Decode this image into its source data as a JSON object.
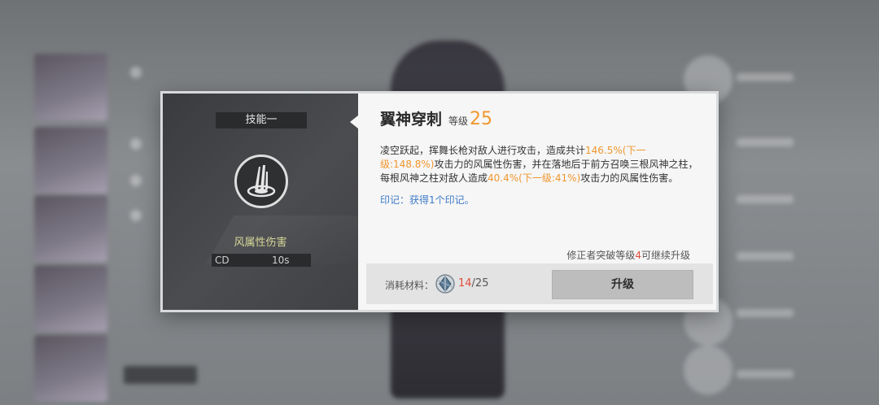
{
  "dialog": {
    "skill_slot": "技能一",
    "skill_icon": "wind-spear-skill-icon",
    "damage_type": "风属性伤害",
    "cd_label": "CD",
    "cd_value": "10s",
    "title": "翼神穿刺",
    "level_label": "等级",
    "level_value": "25",
    "description": {
      "p1": "凌空跃起，挥舞长枪对敌人进行攻击，造成共计",
      "v1": "146.5%(下一级:148.8%)",
      "p2": "攻击力的风属性伤害，并在落地后于前方召唤三根风神之柱，每根风神之柱对敌人造成",
      "v2": "40.4%(下一级:41%)",
      "p3": "攻击力的风属性伤害。"
    },
    "mark": "印记：获得1个印记。",
    "upgrade_note": {
      "pre": "修正者突破等级",
      "level": "4",
      "post": "可继续升级"
    },
    "materials_label": "消耗材料：",
    "material_icon": "crystal-material-icon",
    "material_owned": "14",
    "material_required": "/25",
    "upgrade_button": "升级"
  },
  "colors": {
    "highlight": "#f0972e",
    "mark": "#3e7bc8",
    "warning": "#e24c3c"
  }
}
